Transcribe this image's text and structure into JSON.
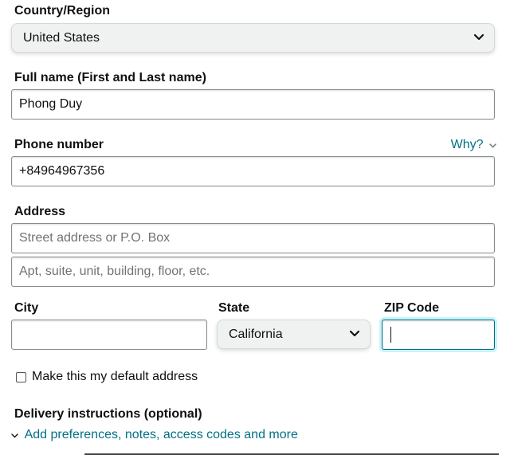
{
  "country": {
    "label": "Country/Region",
    "value": "United States"
  },
  "full_name": {
    "label": "Full name (First and Last name)",
    "value": "Phong Duy"
  },
  "phone": {
    "label": "Phone number",
    "why_link": "Why?",
    "value": "+84964967356"
  },
  "address": {
    "label": "Address",
    "line1_placeholder": "Street address or P.O. Box",
    "line2_placeholder": "Apt, suite, unit, building, floor, etc."
  },
  "city": {
    "label": "City",
    "value": ""
  },
  "state": {
    "label": "State",
    "value": "California"
  },
  "zip": {
    "label": "ZIP Code",
    "value": ""
  },
  "default_address": {
    "label": "Make this my default address",
    "checked": false
  },
  "delivery": {
    "heading": "Delivery instructions (optional)",
    "link": "Add preferences, notes, access codes and more"
  },
  "colors": {
    "link": "#007185",
    "focus_ring": "#c8f3fa",
    "select_bg": "#f0f2f2"
  }
}
